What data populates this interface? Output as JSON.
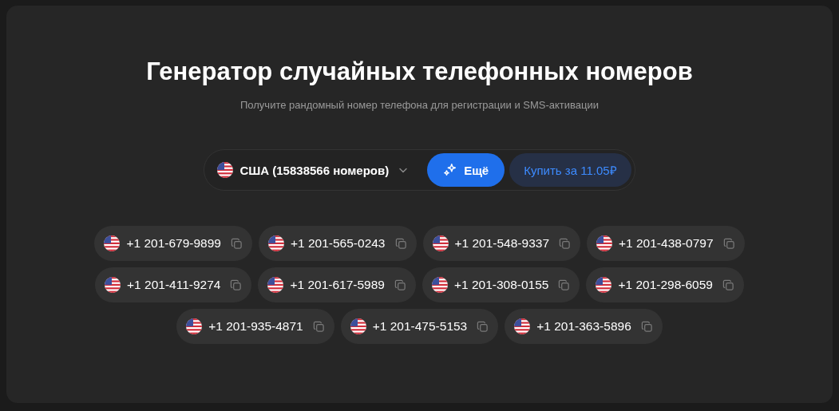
{
  "title": "Генератор случайных телефонных номеров",
  "subtitle": "Получите рандомный номер телефона для регистрации и SMS-активации",
  "country_select": {
    "value": "США (15838566 номеров)"
  },
  "more_button": {
    "label": "Ещё"
  },
  "buy_button": {
    "label": "Купить за 11.05₽"
  },
  "numbers": [
    "+1 201-679-9899",
    "+1 201-565-0243",
    "+1 201-548-9337",
    "+1 201-438-0797",
    "+1 201-411-9274",
    "+1 201-617-5989",
    "+1 201-308-0155",
    "+1 201-298-6059",
    "+1 201-935-4871",
    "+1 201-475-5153",
    "+1 201-363-5896"
  ]
}
